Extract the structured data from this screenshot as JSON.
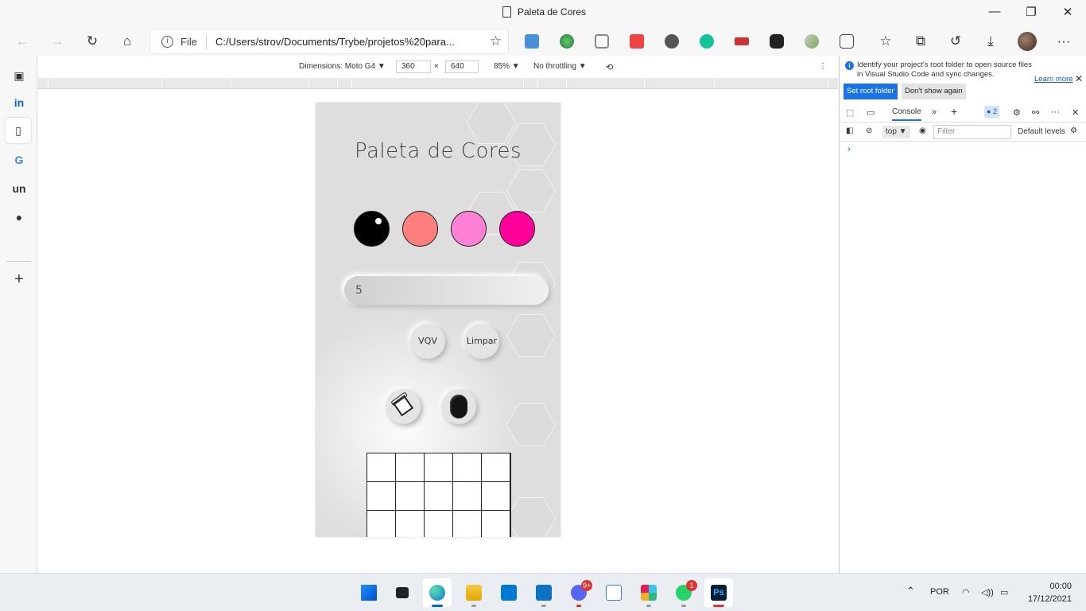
{
  "window": {
    "title": "Paleta de Cores",
    "minimize": "—",
    "maximize": "❐",
    "close": "✕"
  },
  "toolbar": {
    "back": "←",
    "forward": "→",
    "refresh": "↻",
    "home": "⌂",
    "address": {
      "scheme": "File",
      "url": "C:/Users/strov/Documents/Trybe/projetos%20para...",
      "info": "i"
    },
    "favorites": "☆",
    "collections": "⧉",
    "history": "↺",
    "downloads": "⤓",
    "more": "···"
  },
  "sidebar": {
    "items": [
      "tab-actions",
      "linkedin",
      "document",
      "google",
      "unsplash",
      "tiktok"
    ],
    "add": "+"
  },
  "device_toolbar": {
    "dimensions_label": "Dimensions: Moto G4",
    "width": "360",
    "times": "×",
    "height": "640",
    "zoom": "85%",
    "throttling": "No throttling",
    "more": "⋮"
  },
  "app": {
    "title": "Paleta de Cores",
    "colors": [
      {
        "name": "black",
        "hex": "#000000",
        "selected": true
      },
      {
        "name": "salmon",
        "hex": "#ff7f7f"
      },
      {
        "name": "light-pink",
        "hex": "#ff80d5"
      },
      {
        "name": "pink",
        "hex": "#ff009a"
      }
    ],
    "board_size_value": "5",
    "vqv_label": "VQV",
    "clear_label": "Limpar",
    "board": {
      "columns": 5,
      "visible_rows": 3
    }
  },
  "devtools": {
    "info_message": "Identify your project's root folder to open source files in Visual Studio Code and sync changes.",
    "learn_more": "Learn more",
    "set_root": "Set root folder",
    "dont_show": "Don't show again",
    "console_tab": "Console",
    "issues_count": "2",
    "context": "top",
    "filter_placeholder": "Filter",
    "levels": "Default levels",
    "prompt": "›"
  },
  "taskbar": {
    "apps": [
      "windows-start",
      "task-view",
      "edge",
      "file-explorer",
      "mail",
      "vscode",
      "discord",
      "stocks",
      "slack",
      "whatsapp",
      "photoshop"
    ],
    "discord_badge": "9+",
    "whatsapp_badge": "1",
    "language": "POR",
    "time": "00:00",
    "date": "17/12/2021"
  },
  "accent": "#0067c0"
}
